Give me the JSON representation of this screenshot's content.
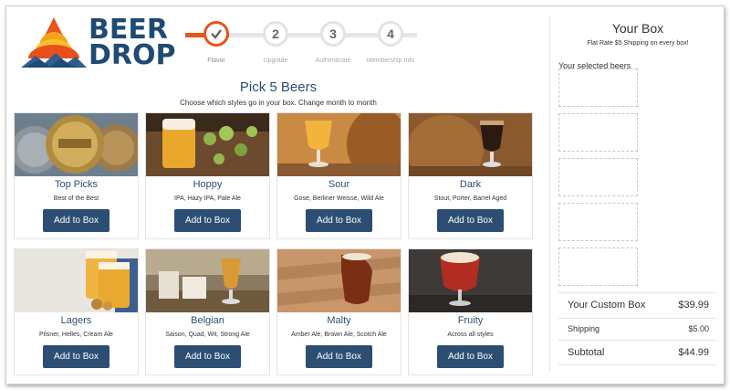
{
  "brand": {
    "line1": "BEER",
    "line2": "DROP"
  },
  "stepper": {
    "steps": [
      {
        "number": "",
        "label": "Flavor"
      },
      {
        "number": "2",
        "label": "Upgrade"
      },
      {
        "number": "3",
        "label": "Authenticate"
      },
      {
        "number": "4",
        "label": "Membership Info"
      }
    ]
  },
  "main": {
    "title": "Pick 5 Beers",
    "subtitle": "Choose which styles go in your box. Change month to month",
    "add_label": "Add to Box",
    "cards": [
      {
        "name": "Top Picks",
        "desc": "Best of the Best"
      },
      {
        "name": "Hoppy",
        "desc": "IPA, Hazy IPA, Pale Ale"
      },
      {
        "name": "Sour",
        "desc": "Gose, Berliner Weisse, Wild Ale"
      },
      {
        "name": "Dark",
        "desc": "Stout, Porter, Barrel Aged"
      },
      {
        "name": "Lagers",
        "desc": "Pilsner, Helles, Cream Ale"
      },
      {
        "name": "Belgian",
        "desc": "Saison, Quad, Wit, Strong Ale"
      },
      {
        "name": "Malty",
        "desc": "Amber Ale, Brown Ale, Scotch Ale"
      },
      {
        "name": "Fruity",
        "desc": "Across all styles"
      }
    ]
  },
  "sidebar": {
    "title": "Your Box",
    "subtitle": "Flat Rate $5 Shipping on every box!",
    "selected_label": "Your selected beers",
    "summary": [
      {
        "label": "Your Custom Box",
        "value": "$39.99"
      },
      {
        "label": "Shipping",
        "value": "$5.00"
      },
      {
        "label": "Subtotal",
        "value": "$44.99"
      }
    ]
  },
  "colors": {
    "brand_blue": "#2c4e73",
    "accent_orange": "#e8541c"
  }
}
